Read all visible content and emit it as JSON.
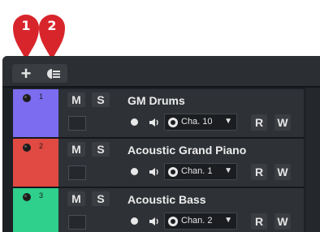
{
  "callouts": [
    {
      "label": "1",
      "color": "#d8252b"
    },
    {
      "label": "2",
      "color": "#d8252b"
    }
  ],
  "toolbar": {
    "add_track_icon": "plus-icon",
    "add_track_from_preset_icon": "add-from-preset-icon"
  },
  "tracks": [
    {
      "number": "1",
      "name": "GM Drums",
      "color": "#7b6cf0",
      "mute_label": "M",
      "solo_label": "S",
      "channel": "Cha. 10",
      "read_label": "R",
      "write_label": "W"
    },
    {
      "number": "2",
      "name": "Acoustic Grand Piano",
      "color": "#e04a43",
      "mute_label": "M",
      "solo_label": "S",
      "channel": "Chan. 1",
      "read_label": "R",
      "write_label": "W"
    },
    {
      "number": "3",
      "name": "Acoustic Bass",
      "color": "#2fcf8c",
      "mute_label": "M",
      "solo_label": "S",
      "channel": "Chan. 2",
      "read_label": "R",
      "write_label": "W"
    }
  ]
}
